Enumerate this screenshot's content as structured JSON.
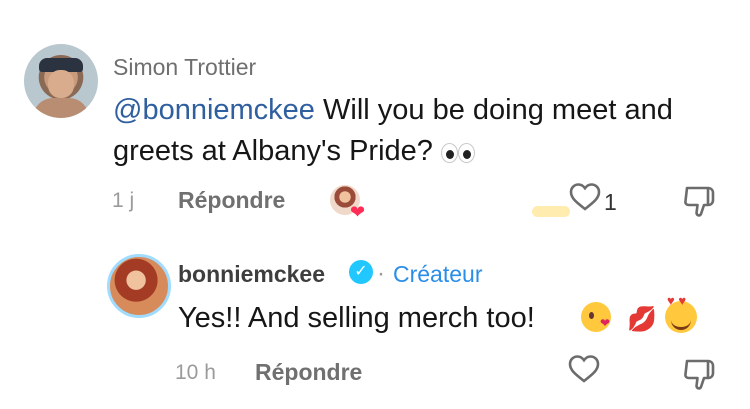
{
  "comments": [
    {
      "author": "Simon Trottier",
      "mention": "@bonniemckee",
      "text": " Will you be doing meet and greets at Albany's Pride?",
      "emoji": "eyes-emoji",
      "time": "1 j",
      "reply_label": "Répondre",
      "likes": "1",
      "liked_by_creator": true
    },
    {
      "author": "bonniemckee",
      "verified": true,
      "separator": "·",
      "badge": "Créateur",
      "text": "Yes!! And selling merch too!",
      "emojis": [
        "kiss-emoji",
        "lips-emoji",
        "smiling-face-with-hearts-emoji"
      ],
      "time": "10 h",
      "reply_label": "Répondre"
    }
  ],
  "colors": {
    "mention": "#2f5f9f",
    "creator_badge": "#2a8ee8",
    "verified": "#20c8ff",
    "secondary_text": "#707070"
  },
  "icons": {
    "like": "heart-outline-icon",
    "dislike": "thumbs-down-icon",
    "creator_heart": "creator-heart-icon"
  }
}
